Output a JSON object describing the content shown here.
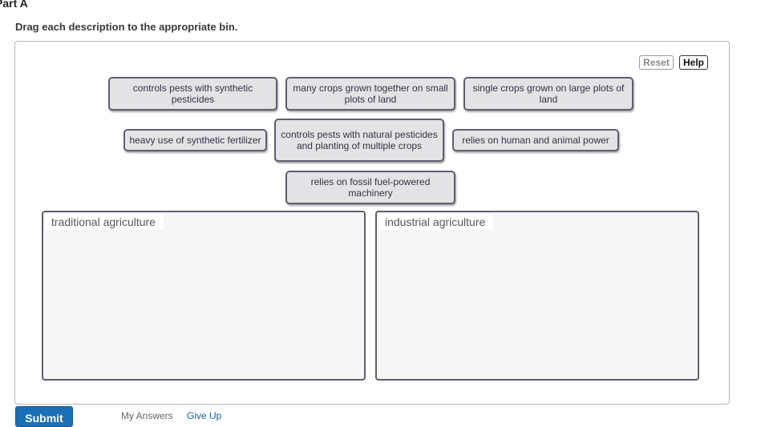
{
  "header": {
    "part_title": "Part A",
    "instructions": "Drag each description to the appropriate bin."
  },
  "toolbar": {
    "reset_label": "Reset",
    "help_label": "Help"
  },
  "chips": [
    {
      "text": "controls pests with synthetic pesticides"
    },
    {
      "text": "many crops grown together on small plots of land"
    },
    {
      "text": "single crops grown on large plots of land"
    },
    {
      "text": "heavy use of synthetic fertilizer"
    },
    {
      "text": "controls pests with natural pesticides and planting of multiple crops"
    },
    {
      "text": "relies on human and animal power"
    },
    {
      "text": "relies on fossil fuel-powered machinery"
    }
  ],
  "bins": [
    {
      "label": "traditional agriculture"
    },
    {
      "label": "industrial agriculture"
    }
  ],
  "footer": {
    "submit_label": "Submit",
    "my_answers_label": "My Answers",
    "give_up_label": "Give Up"
  }
}
